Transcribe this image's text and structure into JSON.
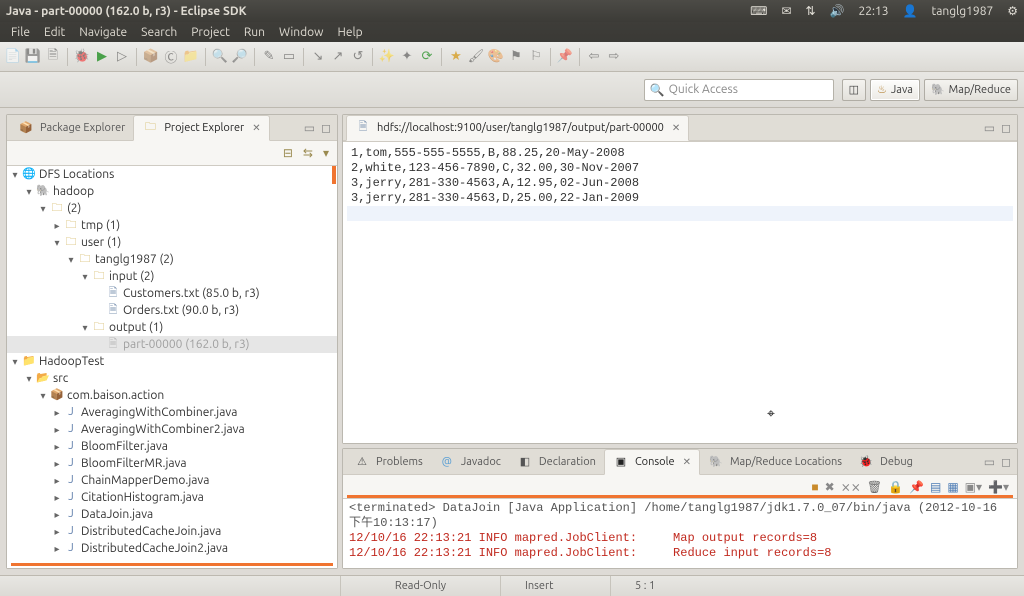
{
  "title": "Java - part-00000 (162.0 b, r3) - Eclipse SDK",
  "system_tray": {
    "time": "22:13",
    "user": "tanglg1987"
  },
  "menu": [
    "File",
    "Edit",
    "Navigate",
    "Search",
    "Project",
    "Run",
    "Window",
    "Help"
  ],
  "quick_access": {
    "placeholder": "Quick Access"
  },
  "perspectives": {
    "java": "Java",
    "mapreduce": "Map/Reduce"
  },
  "left_tabs": {
    "package_explorer": "Package Explorer",
    "project_explorer": "Project Explorer"
  },
  "tree": {
    "dfs": "DFS Locations",
    "hadoop": "hadoop",
    "two": "(2)",
    "tmp": "tmp (1)",
    "user": "user (1)",
    "tanglg": "tanglg1987 (2)",
    "input": "input (2)",
    "customers": "Customers.txt (85.0 b, r3)",
    "orders": "Orders.txt (90.0 b, r3)",
    "output": "output (1)",
    "part": "part-00000 (162.0 b, r3)",
    "hadooptest": "HadoopTest",
    "src": "src",
    "pkg": "com.baison.action",
    "j1": "AveragingWithCombiner.java",
    "j2": "AveragingWithCombiner2.java",
    "j3": "BloomFilter.java",
    "j4": "BloomFilterMR.java",
    "j5": "ChainMapperDemo.java",
    "j6": "CitationHistogram.java",
    "j7": "DataJoin.java",
    "j8": "DistributedCacheJoin.java",
    "j9": "DistributedCacheJoin2.java"
  },
  "editor_tab": "hdfs://localhost:9100/user/tanglg1987/output/part-00000",
  "editor_lines": [
    "1,tom,555-555-5555,B,88.25,20-May-2008",
    "2,white,123-456-7890,C,32.00,30-Nov-2007",
    "3,jerry,281-330-4563,A,12.95,02-Jun-2008",
    "3,jerry,281-330-4563,D,25.00,22-Jan-2009"
  ],
  "bottom_tabs": {
    "problems": "Problems",
    "javadoc": "Javadoc",
    "declaration": "Declaration",
    "console": "Console",
    "mapred": "Map/Reduce Locations",
    "debug": "Debug"
  },
  "console": {
    "header": "<terminated> DataJoin [Java Application] /home/tanglg1987/jdk1.7.0_07/bin/java (2012-10-16 下午10:13:17)",
    "line1": "12/10/16 22:13:21 INFO mapred.JobClient:     Map output records=8",
    "line2": "12/10/16 22:13:21 INFO mapred.JobClient:     Reduce input records=8"
  },
  "status": {
    "readonly": "Read-Only",
    "insert": "Insert",
    "pos": "5 : 1"
  }
}
